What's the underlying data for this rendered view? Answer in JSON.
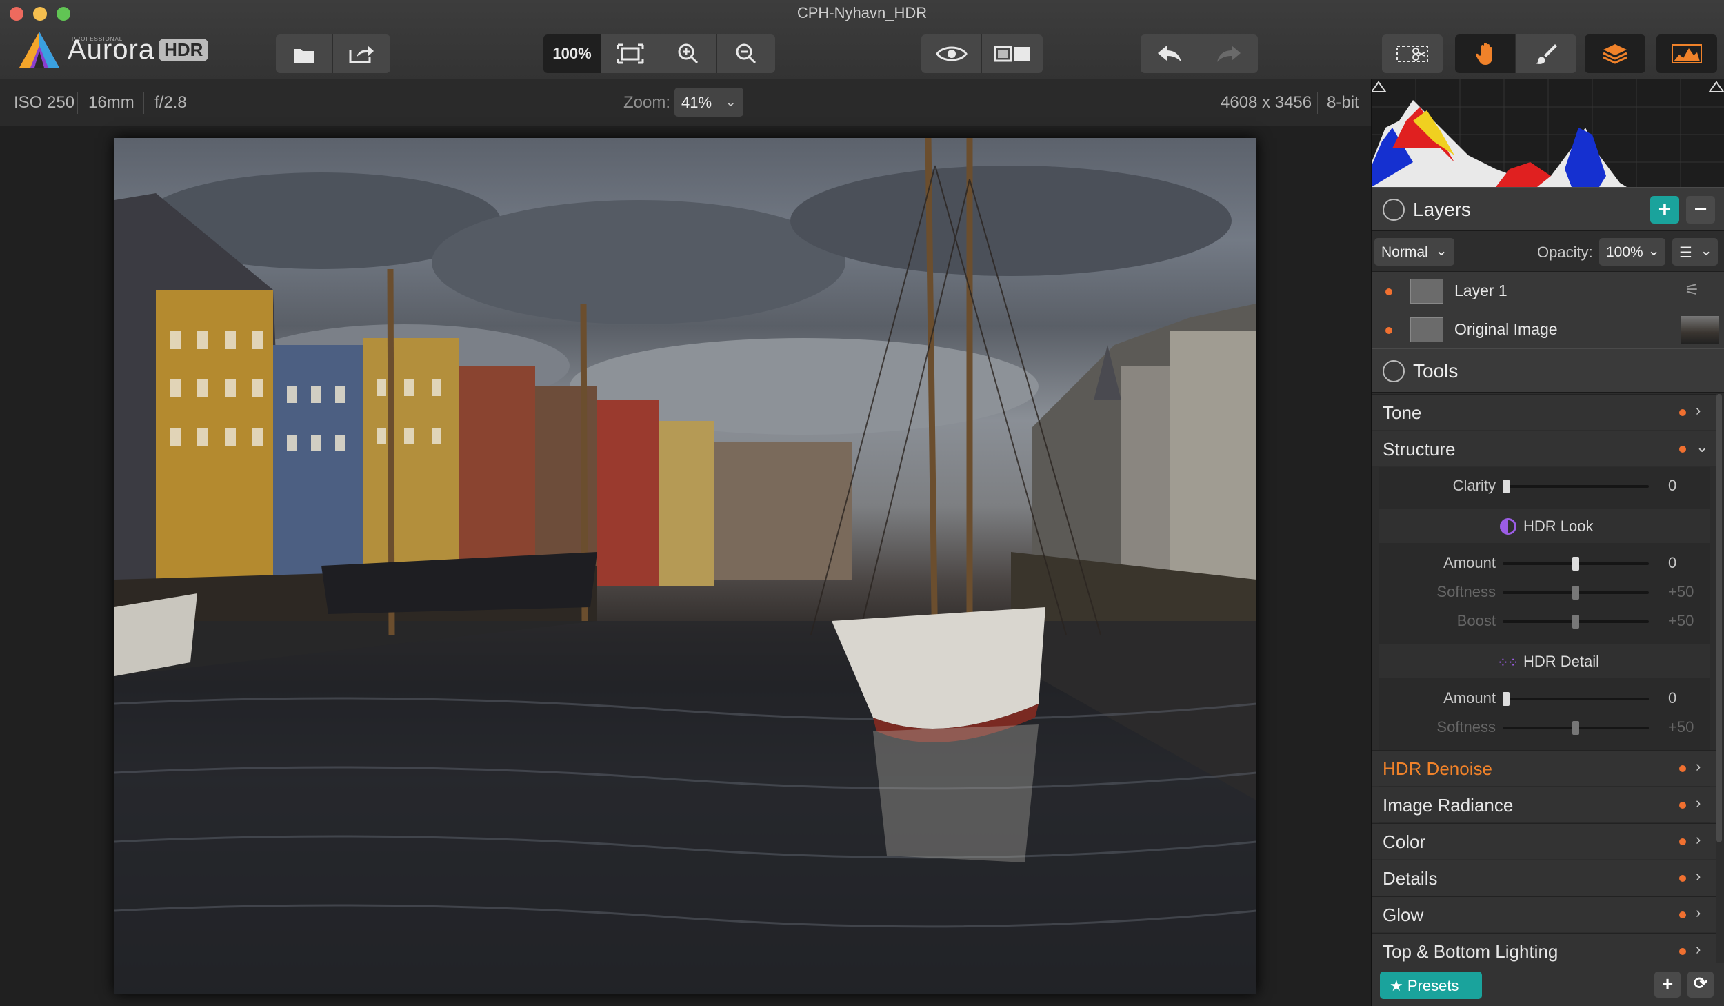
{
  "window": {
    "title": "CPH-Nyhavn_HDR",
    "traffic": {
      "close": "#ed6a5e",
      "minimize": "#f5bf4f",
      "maximize": "#61c554"
    }
  },
  "app": {
    "logo_pro": "PROFESSIONAL",
    "logo_name": "Aurora",
    "logo_badge": "HDR"
  },
  "toolbar": {
    "zoom_100": "100%",
    "buttons": {
      "open": "open-icon",
      "share": "share-icon",
      "fit": "fit-screen-icon",
      "zoom_in": "zoom-in-icon",
      "zoom_out": "zoom-out-icon",
      "preview": "eye-icon",
      "compare": "compare-icon",
      "undo": "undo-icon",
      "redo": "redo-icon",
      "crop": "crop-icon",
      "hand": "hand-icon",
      "brush": "brush-icon",
      "layers": "layers-icon",
      "histogram": "histogram-icon"
    }
  },
  "info": {
    "iso": "ISO 250",
    "focal": "16mm",
    "aperture": "f/2.8",
    "zoom_label": "Zoom:",
    "zoom_value": "41%",
    "dimensions": "4608 x 3456",
    "bitdepth": "8-bit"
  },
  "layers": {
    "title": "Layers",
    "blend_mode": "Normal",
    "opacity_label": "Opacity:",
    "opacity_value": "100%",
    "items": [
      {
        "name": "Layer 1"
      },
      {
        "name": "Original Image"
      }
    ]
  },
  "tools": {
    "title": "Tools",
    "tone": "Tone",
    "structure": "Structure",
    "clarity": {
      "label": "Clarity",
      "value": "0",
      "level": 0
    },
    "hdr_look": {
      "title": "HDR Look",
      "amount": {
        "label": "Amount",
        "value": "0",
        "level": 0.5
      },
      "softness": {
        "label": "Softness",
        "value": "+50",
        "level": 0.5
      },
      "boost": {
        "label": "Boost",
        "value": "+50",
        "level": 0.5
      }
    },
    "hdr_detail": {
      "title": "HDR Detail",
      "amount": {
        "label": "Amount",
        "value": "0",
        "level": 0
      },
      "softness": {
        "label": "Softness",
        "value": "+50",
        "level": 0.5
      }
    },
    "list": [
      "HDR Denoise",
      "Image Radiance",
      "Color",
      "Details",
      "Glow",
      "Top & Bottom Lighting"
    ],
    "highlight_color": "#f0822a"
  },
  "bottom": {
    "presets": "Presets"
  },
  "colors": {
    "accent_teal": "#1aa39c",
    "active_dot": "#f07030"
  }
}
